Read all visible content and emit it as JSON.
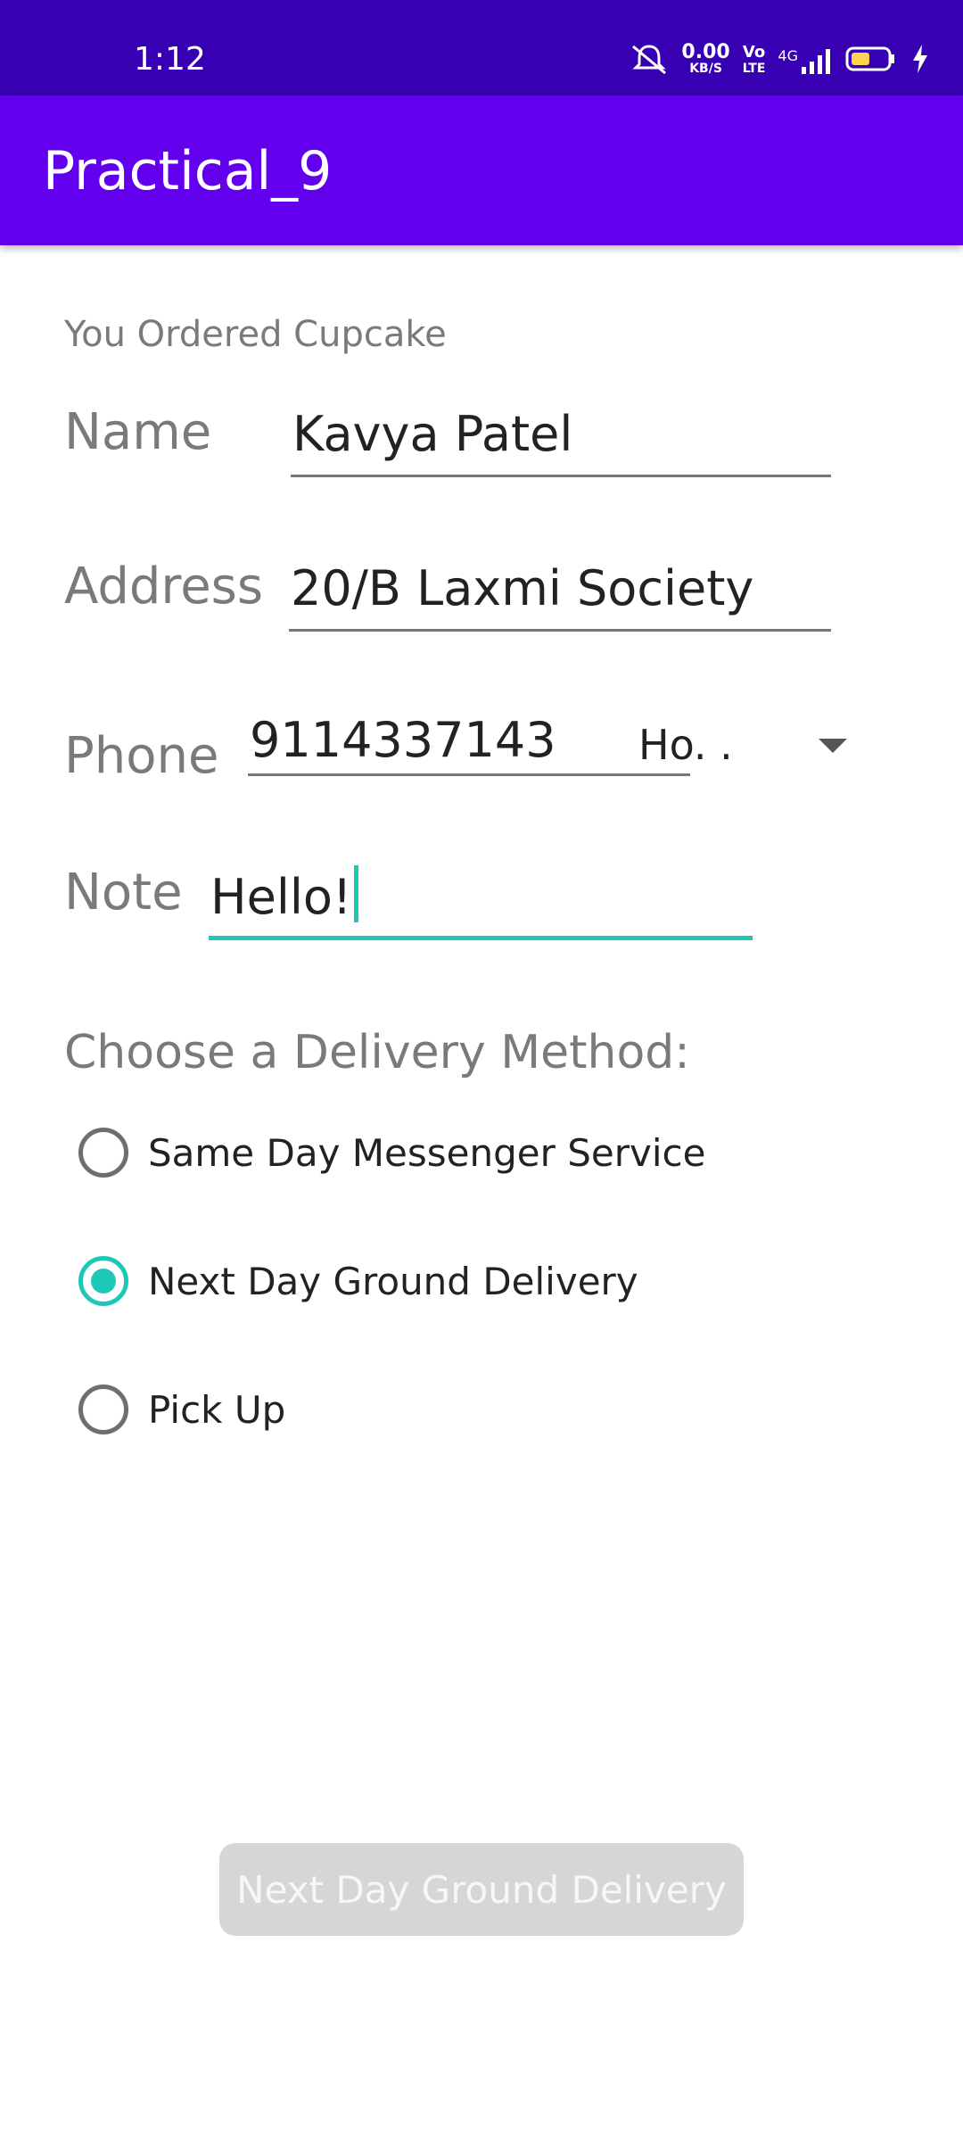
{
  "status_bar": {
    "time": "1:12",
    "speed_value": "0.00",
    "speed_unit": "KB/S",
    "volte_top": "Vo",
    "volte_bottom": "LTE",
    "network": "4G"
  },
  "app_bar": {
    "title": "Practical_9"
  },
  "order": {
    "text": "You Ordered Cupcake"
  },
  "form": {
    "name_label": "Name",
    "name_value": "Kavya Patel",
    "address_label": "Address",
    "address_value": "20/B Laxmi Society",
    "phone_label": "Phone",
    "phone_value": "9114337143",
    "phone_type": "Ho. .",
    "note_label": "Note",
    "note_value": "Hello!"
  },
  "delivery": {
    "title": "Choose a Delivery Method:",
    "options": [
      {
        "label": "Same Day Messenger Service",
        "checked": false
      },
      {
        "label": "Next Day Ground Delivery",
        "checked": true
      },
      {
        "label": "Pick Up",
        "checked": false
      }
    ]
  },
  "footer": {
    "button_label": "Next Day Ground Delivery"
  },
  "colors": {
    "status_bar": "#3700b3",
    "app_bar": "#6200ee",
    "accent": "#1ec8b8",
    "disabled_button": "#d6d6d6"
  }
}
